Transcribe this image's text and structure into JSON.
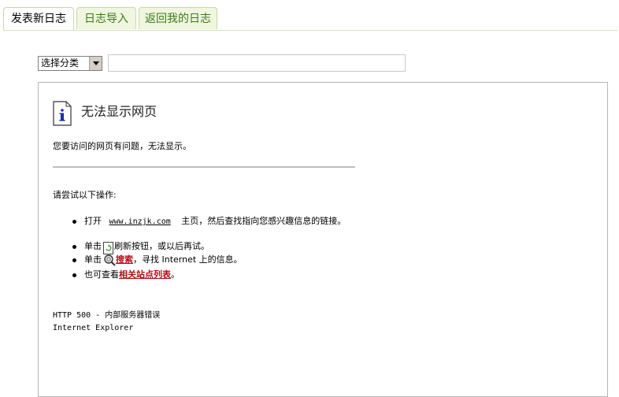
{
  "tabs": [
    {
      "label": "发表新日志",
      "active": true
    },
    {
      "label": "日志导入",
      "active": false
    },
    {
      "label": "返回我的日志",
      "active": false
    }
  ],
  "category_select": {
    "value": "选择分类"
  },
  "title_input": {
    "value": ""
  },
  "error_page": {
    "title": "无法显示网页",
    "description": "您要访问的网页有问题，无法显示。",
    "try_heading": "请尝试以下操作:",
    "items": {
      "open_prefix": "打开",
      "open_link": "www.inzjk.com",
      "open_suffix": "主页，然后查找指向您感兴趣信息的链接。",
      "refresh_prefix": "单击",
      "refresh_suffix": "刷新按钮，或以后再试。",
      "search_prefix": "单击",
      "search_link": "搜索",
      "search_suffix": "，寻找 Internet 上的信息。",
      "related_prefix": "也可查看",
      "related_link": "相关站点列表",
      "related_suffix": "。"
    },
    "http_status": "HTTP 500 - 内部服务器错误",
    "browser": "Internet Explorer"
  }
}
